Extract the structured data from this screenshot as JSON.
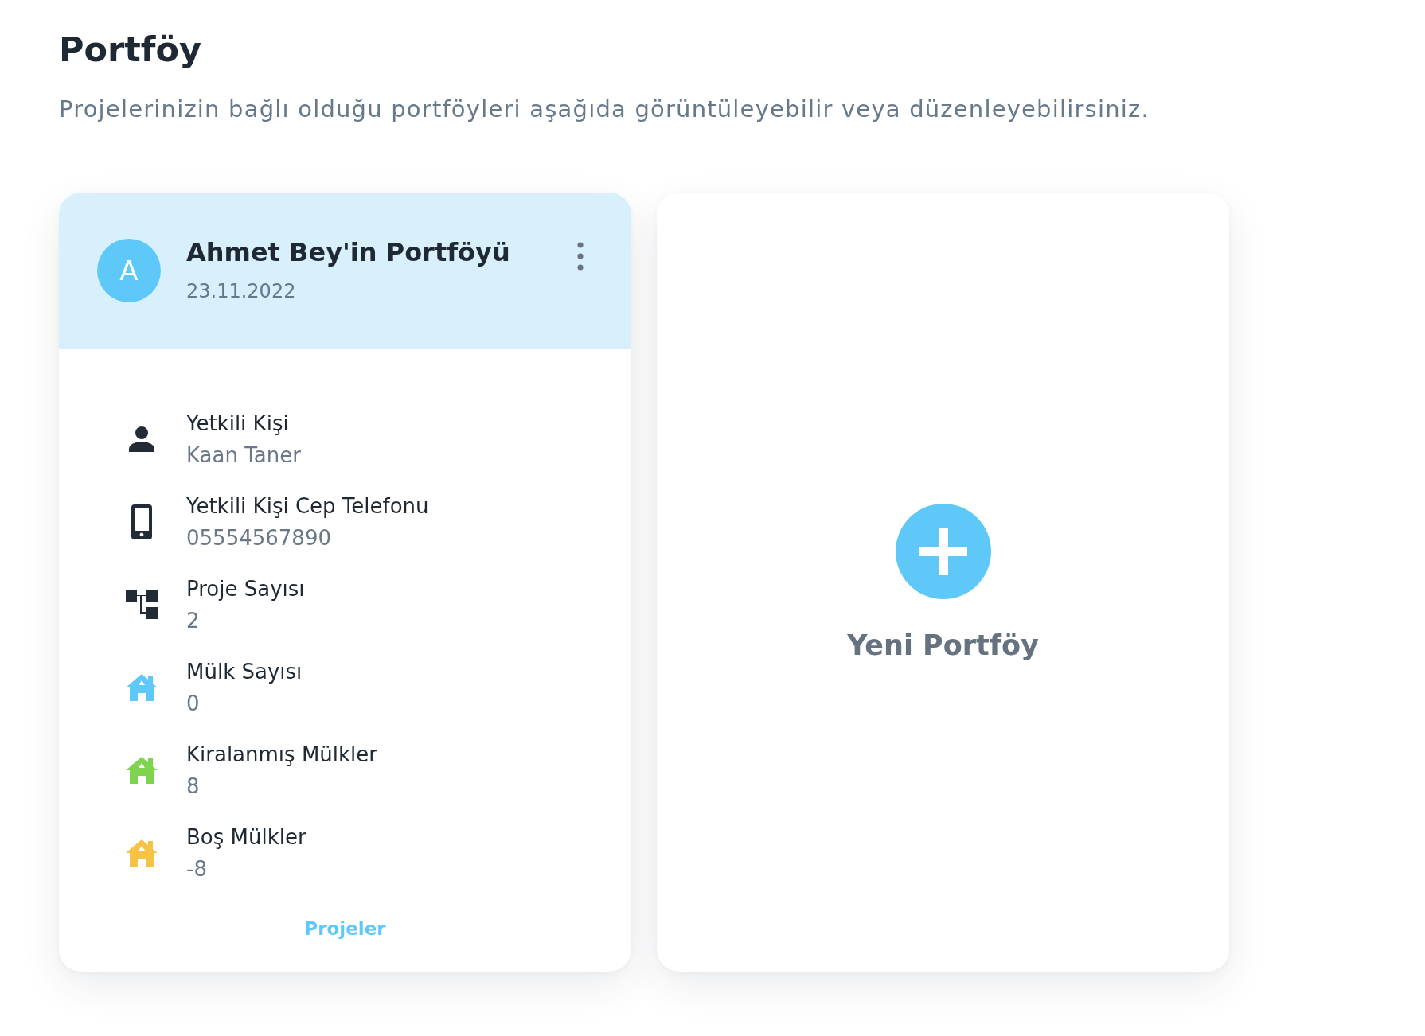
{
  "page": {
    "title": "Portföy",
    "subtitle": "Projelerinizin bağlı olduğu portföyleri aşağıda görüntüleyebilir veya düzenleyebilirsiniz."
  },
  "portfolios": [
    {
      "avatar_letter": "A",
      "name": "Ahmet Bey'in Portföyü",
      "date": "23.11.2022",
      "details": [
        {
          "kind": "person",
          "color": "#222b36",
          "label": "Yetkili Kişi",
          "value": "Kaan Taner"
        },
        {
          "kind": "phone",
          "color": "#222b36",
          "label": "Yetkili Kişi Cep Telefonu",
          "value": "05554567890"
        },
        {
          "kind": "hierarchy",
          "color": "#222b36",
          "label": "Proje Sayısı",
          "value": "2"
        },
        {
          "kind": "house",
          "color": "#5ec9f8",
          "label": "Mülk Sayısı",
          "value": "0"
        },
        {
          "kind": "house",
          "color": "#7ed34f",
          "label": "Kiralanmış Mülkler",
          "value": "8"
        },
        {
          "kind": "house",
          "color": "#f6c344",
          "label": "Boş Mülkler",
          "value": "-8"
        }
      ],
      "link": "Projeler"
    }
  ],
  "new_portfolio": {
    "label": "Yeni Portföy"
  }
}
